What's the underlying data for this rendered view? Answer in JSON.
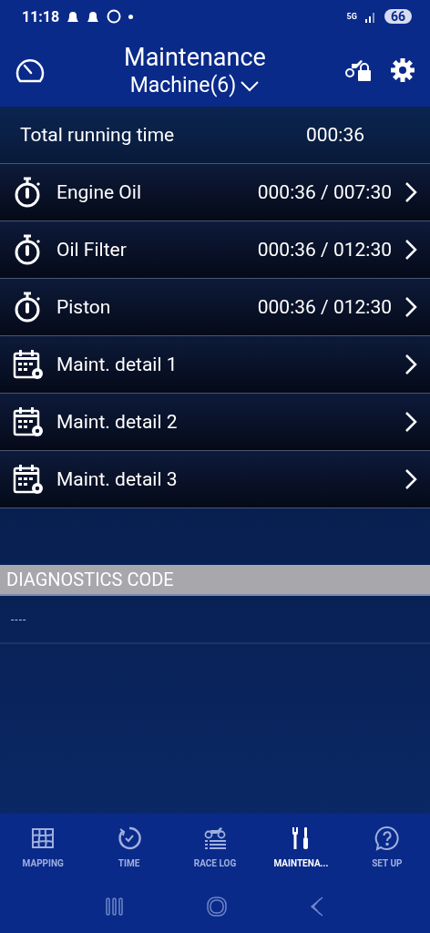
{
  "status_bar": {
    "time": "11:18",
    "battery": "66",
    "network": "5G"
  },
  "header": {
    "title": "Maintenance",
    "subtitle": "Machine(6)"
  },
  "total": {
    "label": "Total running time",
    "value": "000:36"
  },
  "items": [
    {
      "kind": "timer",
      "label": "Engine Oil",
      "value": "000:36 / 007:30"
    },
    {
      "kind": "timer",
      "label": "Oil Filter",
      "value": "000:36 / 012:30"
    },
    {
      "kind": "timer",
      "label": "Piston",
      "value": "000:36 / 012:30"
    },
    {
      "kind": "calendar",
      "label": "Maint. detail 1"
    },
    {
      "kind": "calendar",
      "label": "Maint. detail 2"
    },
    {
      "kind": "calendar",
      "label": "Maint. detail 3"
    }
  ],
  "diagnostics": {
    "title": "DIAGNOSTICS CODE",
    "value": "----"
  },
  "bottom_nav": [
    {
      "kind": "map",
      "label": "MAPPING",
      "selected": false
    },
    {
      "kind": "time",
      "label": "TIME",
      "selected": false
    },
    {
      "kind": "racelog",
      "label": "RACE LOG",
      "selected": false
    },
    {
      "kind": "tools",
      "label": "MAINTENA...",
      "selected": true
    },
    {
      "kind": "help",
      "label": "SET UP",
      "selected": false
    }
  ]
}
